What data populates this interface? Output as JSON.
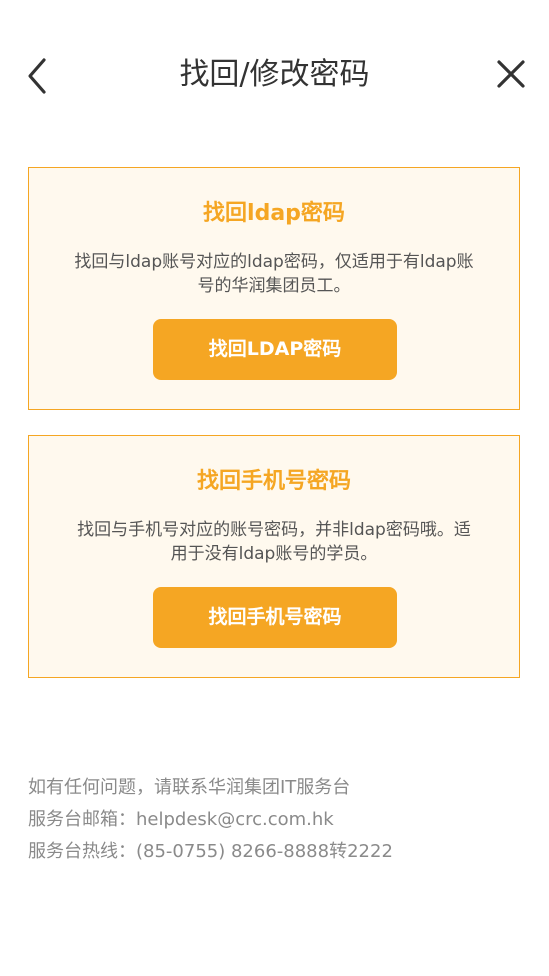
{
  "header": {
    "title": "找回/修改密码",
    "back_icon": "chevron-left-icon",
    "close_icon": "close-icon"
  },
  "cards": {
    "ldap": {
      "title": "找回ldap密码",
      "description": "找回与ldap账号对应的ldap密码，仅适用于有ldap账号的华润集团员工。",
      "button_label": "找回LDAP密码"
    },
    "phone": {
      "title": "找回手机号密码",
      "description": "找回与手机号对应的账号密码，并非ldap密码哦。适用于没有ldap账号的学员。",
      "button_label": "找回手机号密码"
    }
  },
  "footer": {
    "line1": "如有任何问题，请联系华润集团IT服务台",
    "line2": "服务台邮箱：helpdesk@crc.com.hk",
    "line3": "服务台热线：(85-0755) 8266-8888转2222"
  },
  "colors": {
    "accent": "#f5a623",
    "card_background": "#fff9ee",
    "footer_text": "#8a8a8a"
  }
}
